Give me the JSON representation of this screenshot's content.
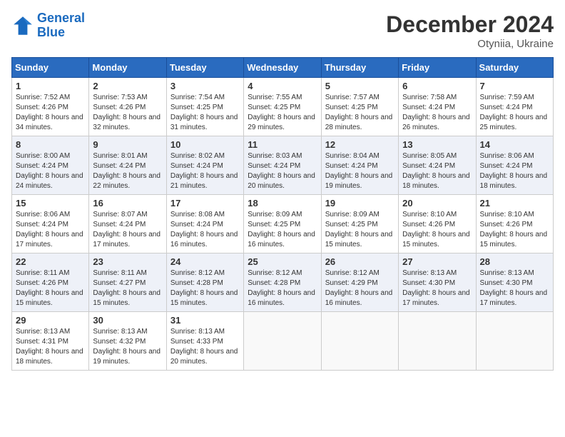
{
  "header": {
    "logo_line1": "General",
    "logo_line2": "Blue",
    "month": "December 2024",
    "location": "Otyniia, Ukraine"
  },
  "days_of_week": [
    "Sunday",
    "Monday",
    "Tuesday",
    "Wednesday",
    "Thursday",
    "Friday",
    "Saturday"
  ],
  "weeks": [
    [
      {
        "day": "1",
        "sunrise": "7:52 AM",
        "sunset": "4:26 PM",
        "daylight": "8 hours and 34 minutes."
      },
      {
        "day": "2",
        "sunrise": "7:53 AM",
        "sunset": "4:26 PM",
        "daylight": "8 hours and 32 minutes."
      },
      {
        "day": "3",
        "sunrise": "7:54 AM",
        "sunset": "4:25 PM",
        "daylight": "8 hours and 31 minutes."
      },
      {
        "day": "4",
        "sunrise": "7:55 AM",
        "sunset": "4:25 PM",
        "daylight": "8 hours and 29 minutes."
      },
      {
        "day": "5",
        "sunrise": "7:57 AM",
        "sunset": "4:25 PM",
        "daylight": "8 hours and 28 minutes."
      },
      {
        "day": "6",
        "sunrise": "7:58 AM",
        "sunset": "4:24 PM",
        "daylight": "8 hours and 26 minutes."
      },
      {
        "day": "7",
        "sunrise": "7:59 AM",
        "sunset": "4:24 PM",
        "daylight": "8 hours and 25 minutes."
      }
    ],
    [
      {
        "day": "8",
        "sunrise": "8:00 AM",
        "sunset": "4:24 PM",
        "daylight": "8 hours and 24 minutes."
      },
      {
        "day": "9",
        "sunrise": "8:01 AM",
        "sunset": "4:24 PM",
        "daylight": "8 hours and 22 minutes."
      },
      {
        "day": "10",
        "sunrise": "8:02 AM",
        "sunset": "4:24 PM",
        "daylight": "8 hours and 21 minutes."
      },
      {
        "day": "11",
        "sunrise": "8:03 AM",
        "sunset": "4:24 PM",
        "daylight": "8 hours and 20 minutes."
      },
      {
        "day": "12",
        "sunrise": "8:04 AM",
        "sunset": "4:24 PM",
        "daylight": "8 hours and 19 minutes."
      },
      {
        "day": "13",
        "sunrise": "8:05 AM",
        "sunset": "4:24 PM",
        "daylight": "8 hours and 18 minutes."
      },
      {
        "day": "14",
        "sunrise": "8:06 AM",
        "sunset": "4:24 PM",
        "daylight": "8 hours and 18 minutes."
      }
    ],
    [
      {
        "day": "15",
        "sunrise": "8:06 AM",
        "sunset": "4:24 PM",
        "daylight": "8 hours and 17 minutes."
      },
      {
        "day": "16",
        "sunrise": "8:07 AM",
        "sunset": "4:24 PM",
        "daylight": "8 hours and 17 minutes."
      },
      {
        "day": "17",
        "sunrise": "8:08 AM",
        "sunset": "4:24 PM",
        "daylight": "8 hours and 16 minutes."
      },
      {
        "day": "18",
        "sunrise": "8:09 AM",
        "sunset": "4:25 PM",
        "daylight": "8 hours and 16 minutes."
      },
      {
        "day": "19",
        "sunrise": "8:09 AM",
        "sunset": "4:25 PM",
        "daylight": "8 hours and 15 minutes."
      },
      {
        "day": "20",
        "sunrise": "8:10 AM",
        "sunset": "4:26 PM",
        "daylight": "8 hours and 15 minutes."
      },
      {
        "day": "21",
        "sunrise": "8:10 AM",
        "sunset": "4:26 PM",
        "daylight": "8 hours and 15 minutes."
      }
    ],
    [
      {
        "day": "22",
        "sunrise": "8:11 AM",
        "sunset": "4:26 PM",
        "daylight": "8 hours and 15 minutes."
      },
      {
        "day": "23",
        "sunrise": "8:11 AM",
        "sunset": "4:27 PM",
        "daylight": "8 hours and 15 minutes."
      },
      {
        "day": "24",
        "sunrise": "8:12 AM",
        "sunset": "4:28 PM",
        "daylight": "8 hours and 15 minutes."
      },
      {
        "day": "25",
        "sunrise": "8:12 AM",
        "sunset": "4:28 PM",
        "daylight": "8 hours and 16 minutes."
      },
      {
        "day": "26",
        "sunrise": "8:12 AM",
        "sunset": "4:29 PM",
        "daylight": "8 hours and 16 minutes."
      },
      {
        "day": "27",
        "sunrise": "8:13 AM",
        "sunset": "4:30 PM",
        "daylight": "8 hours and 17 minutes."
      },
      {
        "day": "28",
        "sunrise": "8:13 AM",
        "sunset": "4:30 PM",
        "daylight": "8 hours and 17 minutes."
      }
    ],
    [
      {
        "day": "29",
        "sunrise": "8:13 AM",
        "sunset": "4:31 PM",
        "daylight": "8 hours and 18 minutes."
      },
      {
        "day": "30",
        "sunrise": "8:13 AM",
        "sunset": "4:32 PM",
        "daylight": "8 hours and 19 minutes."
      },
      {
        "day": "31",
        "sunrise": "8:13 AM",
        "sunset": "4:33 PM",
        "daylight": "8 hours and 20 minutes."
      },
      null,
      null,
      null,
      null
    ]
  ]
}
